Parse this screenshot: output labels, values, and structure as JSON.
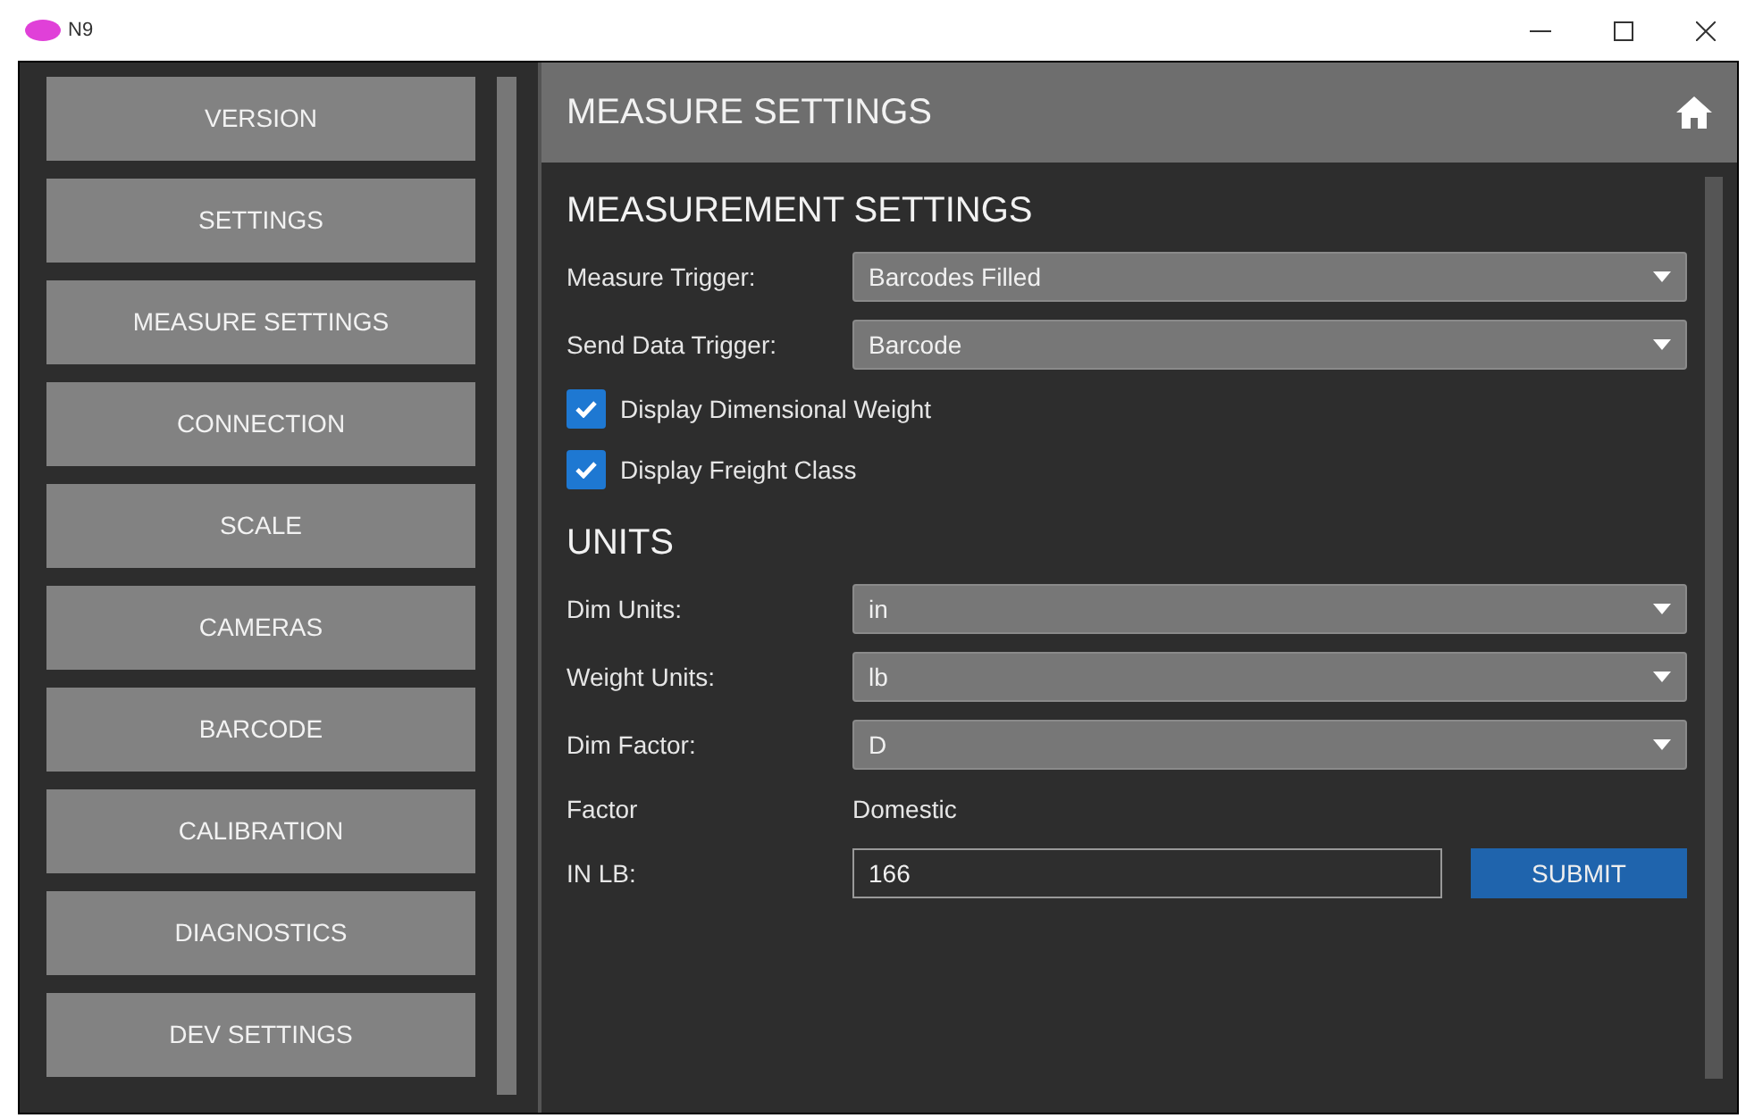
{
  "window": {
    "title": "N9"
  },
  "sidebar": {
    "items": [
      {
        "label": "VERSION"
      },
      {
        "label": "SETTINGS"
      },
      {
        "label": "MEASURE SETTINGS"
      },
      {
        "label": "CONNECTION"
      },
      {
        "label": "SCALE"
      },
      {
        "label": "CAMERAS"
      },
      {
        "label": "BARCODE"
      },
      {
        "label": "CALIBRATION"
      },
      {
        "label": "DIAGNOSTICS"
      },
      {
        "label": "DEV SETTINGS"
      }
    ]
  },
  "header": {
    "title": "MEASURE SETTINGS"
  },
  "sections": [
    {
      "title": "MEASUREMENT SETTINGS",
      "rows": [
        {
          "kind": "dropdown",
          "label": "Measure Trigger:",
          "value": "Barcodes Filled"
        },
        {
          "kind": "dropdown",
          "label": "Send Data Trigger:",
          "value": "Barcode"
        },
        {
          "kind": "checkbox",
          "label": "Display Dimensional Weight",
          "checked": true
        },
        {
          "kind": "checkbox",
          "label": "Display Freight Class",
          "checked": true
        }
      ]
    },
    {
      "title": "UNITS",
      "rows": [
        {
          "kind": "dropdown",
          "label": "Dim Units:",
          "value": "in"
        },
        {
          "kind": "dropdown",
          "label": "Weight Units:",
          "value": "lb"
        },
        {
          "kind": "dropdown",
          "label": "Dim Factor:",
          "value": "D"
        },
        {
          "kind": "info",
          "label": "Factor",
          "value": "Domestic"
        },
        {
          "kind": "input",
          "label": "IN LB:",
          "value": "166",
          "button": "SUBMIT"
        }
      ]
    }
  ]
}
